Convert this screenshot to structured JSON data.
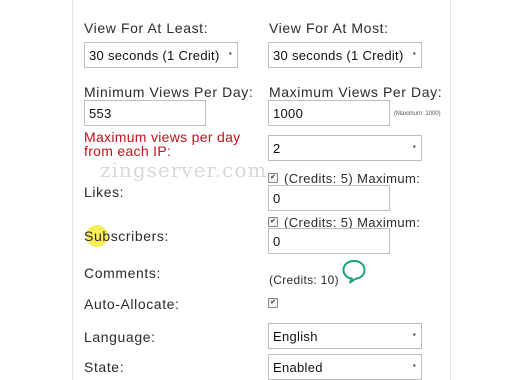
{
  "form": {
    "view_at_least": {
      "label": "View For At Least:",
      "value": "30 seconds (1 Credit)"
    },
    "view_at_most": {
      "label": "View For At Most:",
      "value": "30 seconds (1 Credit)"
    },
    "min_views_per_day": {
      "label": "Minimum Views Per Day:",
      "value": "553"
    },
    "max_views_per_day": {
      "label": "Maximum Views Per Day:",
      "value": "1000",
      "note": "(Maximum: 1000)"
    },
    "max_views_per_ip": {
      "label": "Maximum views per day from each IP:",
      "value": "2"
    },
    "likes": {
      "label": "Likes:",
      "checked": true,
      "text": "(Credits: 5) Maximum:",
      "value": "0"
    },
    "subscribers": {
      "label": "Subscribers:",
      "checked": true,
      "text": "(Credits: 5) Maximum:",
      "value": "0"
    },
    "comments": {
      "label": "Comments:",
      "text": "(Credits: 10)"
    },
    "auto_allocate": {
      "label": "Auto-Allocate:",
      "checked": true
    },
    "language": {
      "label": "Language:",
      "value": "English"
    },
    "state": {
      "label": "State:",
      "value": "Enabled"
    }
  },
  "watermark": "zingserver.com",
  "colors": {
    "warning_label": "#c0121a",
    "chat_icon": "#1aa37a",
    "cursor_highlight": "#f5ea3a"
  },
  "icons": {
    "checkbox": "checkmark",
    "dropdown": "dropdown-arrow",
    "chat": "speech-bubble"
  }
}
